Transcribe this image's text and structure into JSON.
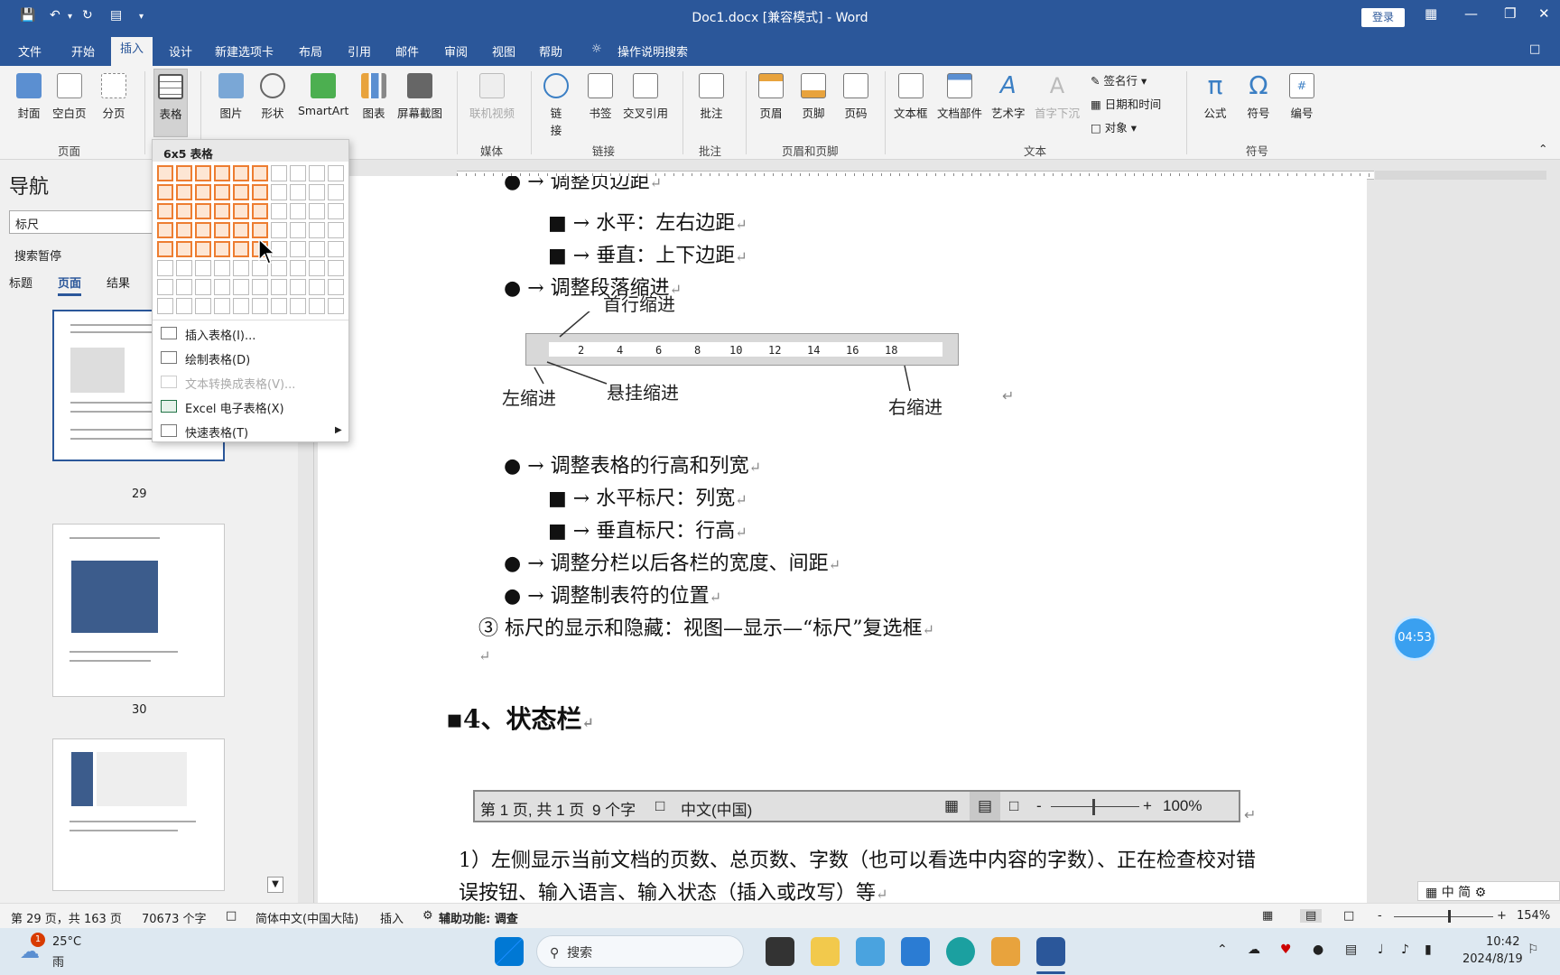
{
  "titlebar": {
    "title": "Doc1.docx [兼容模式]  -  Word",
    "login": "登录"
  },
  "menu": [
    "文件",
    "开始",
    "插入",
    "设计",
    "新建选项卡",
    "布局",
    "引用",
    "邮件",
    "审阅",
    "视图",
    "帮助",
    "操作说明搜索"
  ],
  "ribbon": {
    "page": [
      "封面",
      "空白页",
      "分页"
    ],
    "table": "表格",
    "illus": [
      "图片",
      "形状",
      "SmartArt",
      "图表",
      "屏幕截图"
    ],
    "media": "联机视频",
    "links": [
      "链\n接",
      "书签",
      "交叉引用"
    ],
    "comment": "批注",
    "hf": [
      "页眉",
      "页脚",
      "页码"
    ],
    "text": [
      "文本框",
      "文档部件",
      "艺术字",
      "首字下沉"
    ],
    "textsmall": [
      "签名行",
      "日期和时间",
      "对象"
    ],
    "symbols": [
      "公式",
      "符号",
      "编号"
    ],
    "groups": [
      "页面",
      "媒体",
      "链接",
      "批注",
      "页眉和页脚",
      "文本",
      "符号"
    ]
  },
  "dropdown": {
    "title": "6x5 表格",
    "items": [
      "插入表格(I)...",
      "绘制表格(D)",
      "文本转换成表格(V)...",
      "Excel 电子表格(X)",
      "快速表格(T)"
    ],
    "selected_cols": 6,
    "selected_rows": 5
  },
  "nav": {
    "title": "导航",
    "search": "标尺",
    "status": "搜索暂停",
    "tabs": [
      "标题",
      "页面",
      "结果"
    ],
    "pages": [
      "29",
      "30"
    ]
  },
  "doc": {
    "l1": "● → 调整页边距",
    "l2": "■ → 水平：左右边距",
    "l3": "■ → 垂直：上下边距",
    "l4": "● → 调整段落缩进",
    "fig1": {
      "first": "首行缩进",
      "left": "左缩进",
      "hang": "悬挂缩进",
      "right": "右缩进",
      "ticks": [
        "2",
        "4",
        "6",
        "8",
        "10",
        "12",
        "14",
        "16",
        "18"
      ]
    },
    "l5": "● → 调整表格的行高和列宽",
    "l6": "■ → 水平标尺：列宽",
    "l7": "■ → 垂直标尺：行高",
    "l8": "●  →  调整分栏以后各栏的宽度、间距",
    "l9": "● → 调整制表符的位置",
    "l10": "③ 标尺的显示和隐藏：视图—显示—“标尺”复选框",
    "h4": "4、状态栏",
    "fig2": {
      "page": "第 1 页, 共 1 页",
      "words": "9 个字",
      "lang": "中文(中国)",
      "zoom": "100%"
    },
    "p1": "1）左侧显示当前文档的页数、总页数、字数（也可以看选中内容的字数）、正在检查校对错",
    "p2": "误按钮、输入语言、输入状态（插入或改写）等"
  },
  "timer": "04:53",
  "ime": "中 简",
  "status": {
    "page": "第 29 页，共 163 页",
    "words": "70673 个字",
    "lang": "简体中文(中国大陆)",
    "mode": "插入",
    "access": "辅助功能: 调查",
    "zoom": "154%"
  },
  "taskbar": {
    "temp": "25°C",
    "weather": "雨",
    "badge": "1",
    "search": "搜索",
    "time": "10:42",
    "date": "2024/8/19"
  }
}
